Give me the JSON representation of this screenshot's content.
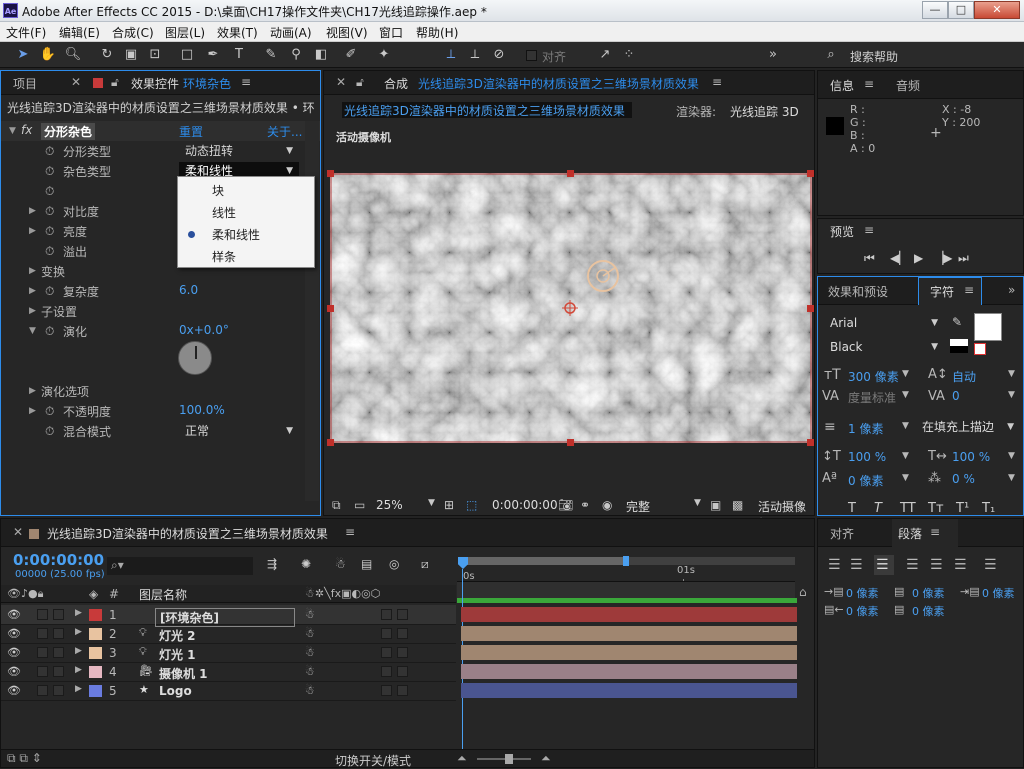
{
  "app": {
    "logo": "Ae",
    "title": "Adobe After Effects CC 2015 - D:\\桌面\\CH17操作文件夹\\CH17光线追踪操作.aep *",
    "win_min": "—",
    "win_max": "□",
    "win_close": "✕"
  },
  "menu": [
    "文件(F)",
    "编辑(E)",
    "合成(C)",
    "图层(L)",
    "效果(T)",
    "动画(A)",
    "视图(V)",
    "窗口",
    "帮助(H)"
  ],
  "toolbar": {
    "align_label": "对齐",
    "search_label": "搜索帮助"
  },
  "effects_panel": {
    "tab_project": "项目",
    "tab_prefix": "效果控件",
    "tab_layer": "环境杂色",
    "header": "光线追踪3D渲染器中的材质设置之三维场景材质效果 • 环",
    "fx_badge": "fx",
    "effect_name": "分形杂色",
    "reset": "重置",
    "about": "关于...",
    "rows": {
      "fractal_type": "分形类型",
      "fractal_type_val": "动态扭转",
      "noise_type": "杂色类型",
      "noise_type_val": "柔和线性",
      "contrast": "对比度",
      "brightness": "亮度",
      "overflow": "溢出",
      "transform": "变换",
      "complexity": "复杂度",
      "complexity_val": "6.0",
      "sub": "子设置",
      "evolution": "演化",
      "evolution_val": "0x+0.0°",
      "evo_options": "演化选项",
      "opacity": "不透明度",
      "opacity_val": "100.0%",
      "blend": "混合模式",
      "blend_val": "正常"
    },
    "popup": [
      "块",
      "线性",
      "柔和线性",
      "样条"
    ]
  },
  "comp_panel": {
    "tab_prefix": "合成",
    "tab_name": "光线追踪3D渲染器中的材质设置之三维场景材质效果",
    "breadcrumb": "光线追踪3D渲染器中的材质设置之三维场景材质效果",
    "renderer_label": "渲染器:",
    "renderer_val": "光线追踪 3D",
    "camera_label": "活动摄像机",
    "zoom": "25%",
    "timecode": "0:00:00:00",
    "quality": "完整",
    "view_label": "活动摄像机"
  },
  "info_panel": {
    "tab_info": "信息",
    "tab_audio": "音频",
    "r": "R :",
    "g": "G :",
    "b": "B :",
    "a": "A : 0",
    "x": "X : -8",
    "y": "Y : 200"
  },
  "preview_panel": {
    "tab": "预览"
  },
  "char_panel": {
    "tab_effects": "效果和预设",
    "tab_char": "字符",
    "font": "Arial",
    "style": "Black",
    "size": "300 像素",
    "leading": "自动",
    "kern_label": "度量标准",
    "track": "0",
    "stroke_w": "1 像素",
    "stroke_mode": "在填充上描边",
    "vscale": "100 %",
    "hscale": "100 %",
    "baseline": "0 像素",
    "tsume": "0 %",
    "fmt": [
      "T",
      "T",
      "TT",
      "Tт",
      "T¹",
      "T₁"
    ]
  },
  "para_panel": {
    "tab_align": "对齐",
    "tab_para": "段落",
    "a1": "0 像素",
    "a2": "0 像素",
    "a3": "0 像素",
    "a4": "0 像素",
    "a5": "0 像素"
  },
  "timeline": {
    "tab": "光线追踪3D渲染器中的材质设置之三维场景材质效果",
    "timecode": "0:00:00:00",
    "fps": "00000 (25.00 fps)",
    "search_placeholder": "",
    "col_layer_name": "图层名称",
    "col_num": "#",
    "ruler_0": "0s",
    "ruler_1": "01s",
    "footer": "切换开关/模式",
    "layers": [
      {
        "num": "1",
        "name": "[环境杂色]",
        "color": "#c83a3a",
        "bar": "#9e3a3a"
      },
      {
        "num": "2",
        "name": "灯光 2",
        "color": "#e8c3a0",
        "bar": "#a08670"
      },
      {
        "num": "3",
        "name": "灯光 1",
        "color": "#e8c3a0",
        "bar": "#a08670"
      },
      {
        "num": "4",
        "name": "摄像机 1",
        "color": "#e6b8c2",
        "bar": "#9a8088"
      },
      {
        "num": "5",
        "name": "Logo",
        "color": "#6a7ce0",
        "bar": "#4a5590"
      }
    ]
  },
  "colors": {
    "accent": "#2d8ceb",
    "timecode": "#4a9ff0"
  }
}
